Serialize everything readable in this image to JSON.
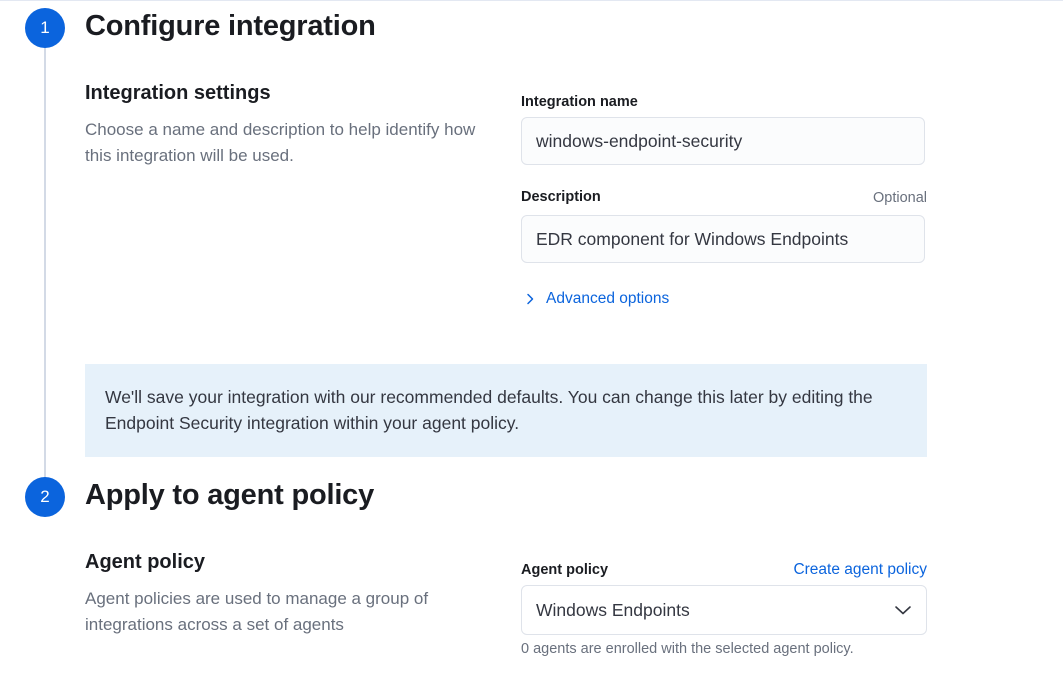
{
  "steps": [
    {
      "number": "1",
      "title": "Configure integration"
    },
    {
      "number": "2",
      "title": "Apply to agent policy"
    }
  ],
  "integration_settings": {
    "title": "Integration settings",
    "description": "Choose a name and description to help identify how this integration will be used.",
    "name_label": "Integration name",
    "name_value": "windows-endpoint-security",
    "description_label": "Description",
    "description_optional": "Optional",
    "description_value": "EDR component for Windows Endpoints",
    "advanced_options": "Advanced options"
  },
  "callout": {
    "text": "We'll save your integration with our recommended defaults. You can change this later by editing the Endpoint Security integration within your agent policy."
  },
  "agent_policy": {
    "title": "Agent policy",
    "description": "Agent policies are used to manage a group of integrations across a set of agents",
    "label": "Agent policy",
    "create_link": "Create agent policy",
    "selected": "Windows Endpoints",
    "help": "0 agents are enrolled with the selected agent policy."
  },
  "icons": {
    "advanced_toggle": "chevron-right-icon",
    "select_arrow": "chevron-down-icon"
  },
  "colors": {
    "accent": "#0b64dd",
    "callout_bg": "#e6f1fa",
    "step_line": "#d3dae6"
  }
}
